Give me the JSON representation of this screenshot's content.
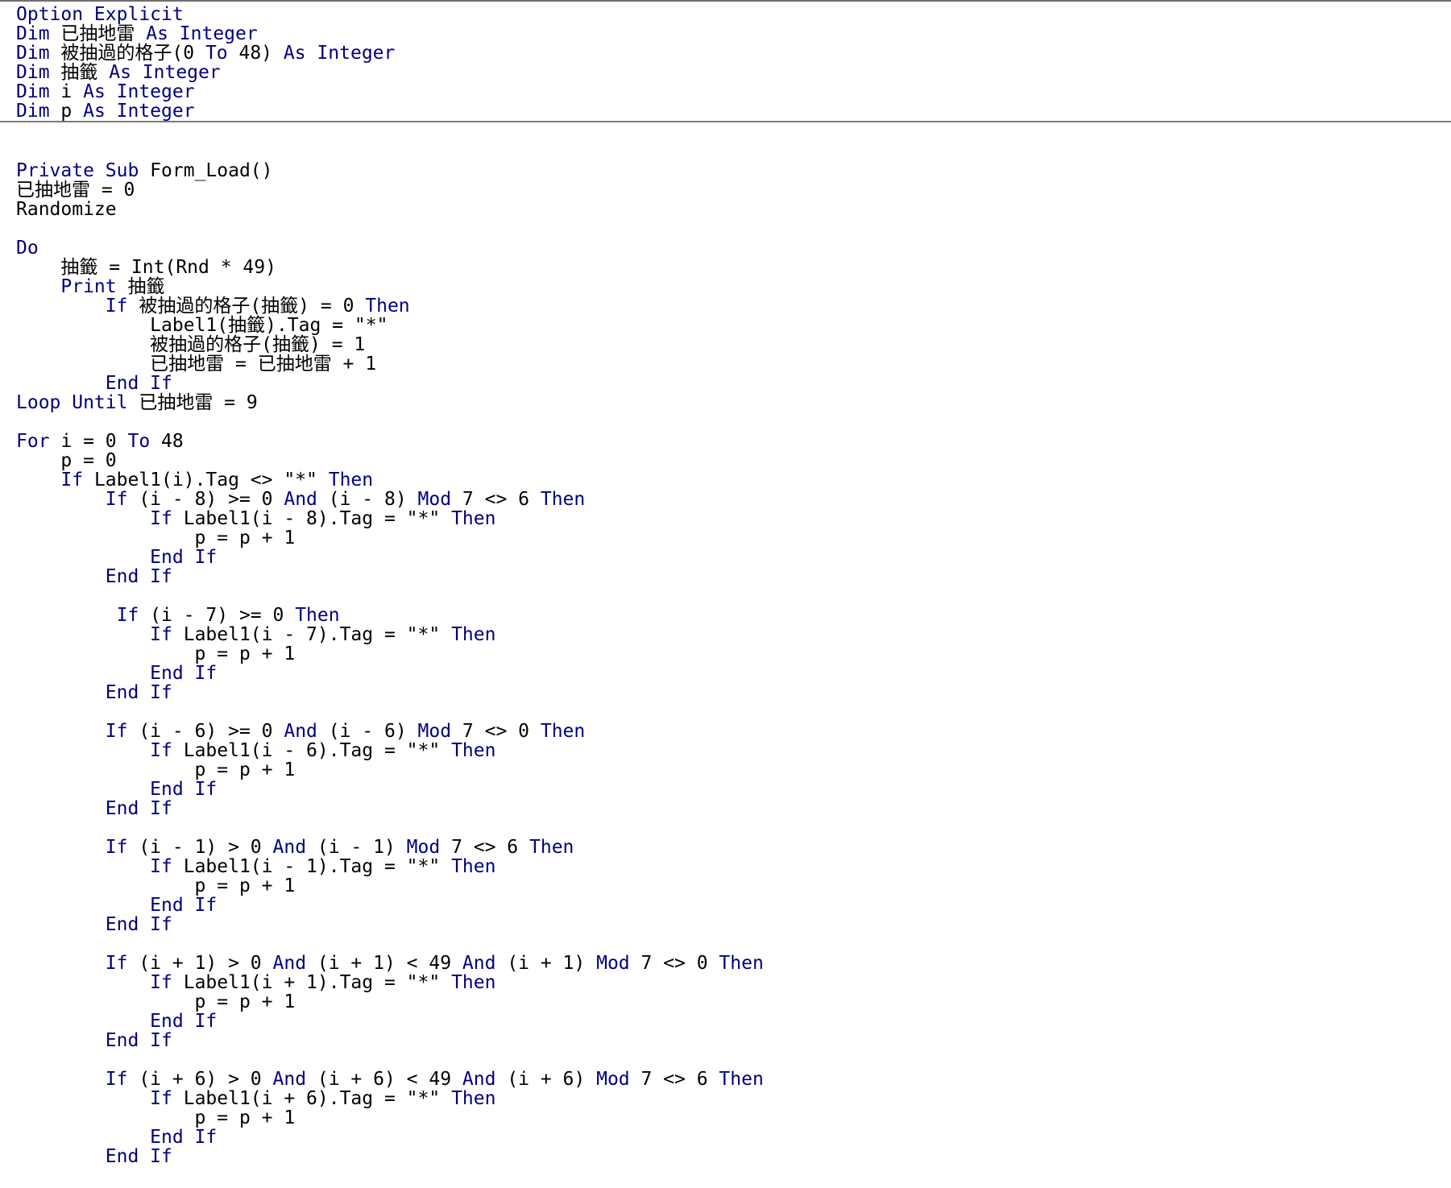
{
  "colors": {
    "keyword": "#00007f",
    "text": "#000000",
    "background": "#ffffff",
    "separator": "#7a7a7a"
  },
  "declarations": [
    [
      {
        "t": "Option Explicit",
        "k": true
      }
    ],
    [
      {
        "t": "Dim",
        "k": true
      },
      {
        "t": " 已抽地雷 "
      },
      {
        "t": "As Integer",
        "k": true
      }
    ],
    [
      {
        "t": "Dim",
        "k": true
      },
      {
        "t": " 被抽過的格子(0 "
      },
      {
        "t": "To",
        "k": true
      },
      {
        "t": " 48) "
      },
      {
        "t": "As Integer",
        "k": true
      }
    ],
    [
      {
        "t": "Dim",
        "k": true
      },
      {
        "t": " 抽籤 "
      },
      {
        "t": "As Integer",
        "k": true
      }
    ],
    [
      {
        "t": "Dim",
        "k": true
      },
      {
        "t": " i "
      },
      {
        "t": "As Integer",
        "k": true
      }
    ],
    [
      {
        "t": "Dim",
        "k": true
      },
      {
        "t": " p "
      },
      {
        "t": "As Integer",
        "k": true
      }
    ]
  ],
  "procedure": [
    [
      {
        "t": "Private Sub",
        "k": true
      },
      {
        "t": " Form_Load()"
      }
    ],
    [
      {
        "t": "已抽地雷 = 0"
      }
    ],
    [
      {
        "t": "Randomize"
      }
    ],
    [
      {
        "t": ""
      }
    ],
    [
      {
        "t": "Do",
        "k": true
      }
    ],
    [
      {
        "t": "    抽籤 = Int(Rnd * 49)"
      }
    ],
    [
      {
        "t": "    "
      },
      {
        "t": "Print",
        "k": true
      },
      {
        "t": " 抽籤"
      }
    ],
    [
      {
        "t": "        "
      },
      {
        "t": "If",
        "k": true
      },
      {
        "t": " 被抽過的格子(抽籤) = 0 "
      },
      {
        "t": "Then",
        "k": true
      }
    ],
    [
      {
        "t": "            Label1(抽籤).Tag = \"*\""
      }
    ],
    [
      {
        "t": "            被抽過的格子(抽籤) = 1"
      }
    ],
    [
      {
        "t": "            已抽地雷 = 已抽地雷 + 1"
      }
    ],
    [
      {
        "t": "        "
      },
      {
        "t": "End If",
        "k": true
      }
    ],
    [
      {
        "t": "Loop Until",
        "k": true
      },
      {
        "t": " 已抽地雷 = 9"
      }
    ],
    [
      {
        "t": ""
      }
    ],
    [
      {
        "t": "For",
        "k": true
      },
      {
        "t": " i = 0 "
      },
      {
        "t": "To",
        "k": true
      },
      {
        "t": " 48"
      }
    ],
    [
      {
        "t": "    p = 0"
      }
    ],
    [
      {
        "t": "    "
      },
      {
        "t": "If",
        "k": true
      },
      {
        "t": " Label1(i).Tag <> \"*\" "
      },
      {
        "t": "Then",
        "k": true
      }
    ],
    [
      {
        "t": "        "
      },
      {
        "t": "If",
        "k": true
      },
      {
        "t": " (i - 8) >= 0 "
      },
      {
        "t": "And",
        "k": true
      },
      {
        "t": " (i - 8) "
      },
      {
        "t": "Mod",
        "k": true
      },
      {
        "t": " 7 <> 6 "
      },
      {
        "t": "Then",
        "k": true
      }
    ],
    [
      {
        "t": "            "
      },
      {
        "t": "If",
        "k": true
      },
      {
        "t": " Label1(i - 8).Tag = \"*\" "
      },
      {
        "t": "Then",
        "k": true
      }
    ],
    [
      {
        "t": "                p = p + 1"
      }
    ],
    [
      {
        "t": "            "
      },
      {
        "t": "End If",
        "k": true
      }
    ],
    [
      {
        "t": "        "
      },
      {
        "t": "End If",
        "k": true
      }
    ],
    [
      {
        "t": ""
      }
    ],
    [
      {
        "t": "         "
      },
      {
        "t": "If",
        "k": true
      },
      {
        "t": " (i - 7) >= 0 "
      },
      {
        "t": "Then",
        "k": true
      }
    ],
    [
      {
        "t": "            "
      },
      {
        "t": "If",
        "k": true
      },
      {
        "t": " Label1(i - 7).Tag = \"*\" "
      },
      {
        "t": "Then",
        "k": true
      }
    ],
    [
      {
        "t": "                p = p + 1"
      }
    ],
    [
      {
        "t": "            "
      },
      {
        "t": "End If",
        "k": true
      }
    ],
    [
      {
        "t": "        "
      },
      {
        "t": "End If",
        "k": true
      }
    ],
    [
      {
        "t": ""
      }
    ],
    [
      {
        "t": "        "
      },
      {
        "t": "If",
        "k": true
      },
      {
        "t": " (i - 6) >= 0 "
      },
      {
        "t": "And",
        "k": true
      },
      {
        "t": " (i - 6) "
      },
      {
        "t": "Mod",
        "k": true
      },
      {
        "t": " 7 <> 0 "
      },
      {
        "t": "Then",
        "k": true
      }
    ],
    [
      {
        "t": "            "
      },
      {
        "t": "If",
        "k": true
      },
      {
        "t": " Label1(i - 6).Tag = \"*\" "
      },
      {
        "t": "Then",
        "k": true
      }
    ],
    [
      {
        "t": "                p = p + 1"
      }
    ],
    [
      {
        "t": "            "
      },
      {
        "t": "End If",
        "k": true
      }
    ],
    [
      {
        "t": "        "
      },
      {
        "t": "End If",
        "k": true
      }
    ],
    [
      {
        "t": ""
      }
    ],
    [
      {
        "t": "        "
      },
      {
        "t": "If",
        "k": true
      },
      {
        "t": " (i - 1) > 0 "
      },
      {
        "t": "And",
        "k": true
      },
      {
        "t": " (i - 1) "
      },
      {
        "t": "Mod",
        "k": true
      },
      {
        "t": " 7 <> 6 "
      },
      {
        "t": "Then",
        "k": true
      }
    ],
    [
      {
        "t": "            "
      },
      {
        "t": "If",
        "k": true
      },
      {
        "t": " Label1(i - 1).Tag = \"*\" "
      },
      {
        "t": "Then",
        "k": true
      }
    ],
    [
      {
        "t": "                p = p + 1"
      }
    ],
    [
      {
        "t": "            "
      },
      {
        "t": "End If",
        "k": true
      }
    ],
    [
      {
        "t": "        "
      },
      {
        "t": "End If",
        "k": true
      }
    ],
    [
      {
        "t": ""
      }
    ],
    [
      {
        "t": "        "
      },
      {
        "t": "If",
        "k": true
      },
      {
        "t": " (i + 1) > 0 "
      },
      {
        "t": "And",
        "k": true
      },
      {
        "t": " (i + 1) < 49 "
      },
      {
        "t": "And",
        "k": true
      },
      {
        "t": " (i + 1) "
      },
      {
        "t": "Mod",
        "k": true
      },
      {
        "t": " 7 <> 0 "
      },
      {
        "t": "Then",
        "k": true
      }
    ],
    [
      {
        "t": "            "
      },
      {
        "t": "If",
        "k": true
      },
      {
        "t": " Label1(i + 1).Tag = \"*\" "
      },
      {
        "t": "Then",
        "k": true
      }
    ],
    [
      {
        "t": "                p = p + 1"
      }
    ],
    [
      {
        "t": "            "
      },
      {
        "t": "End If",
        "k": true
      }
    ],
    [
      {
        "t": "        "
      },
      {
        "t": "End If",
        "k": true
      }
    ],
    [
      {
        "t": ""
      }
    ],
    [
      {
        "t": "        "
      },
      {
        "t": "If",
        "k": true
      },
      {
        "t": " (i + 6) > 0 "
      },
      {
        "t": "And",
        "k": true
      },
      {
        "t": " (i + 6) < 49 "
      },
      {
        "t": "And",
        "k": true
      },
      {
        "t": " (i + 6) "
      },
      {
        "t": "Mod",
        "k": true
      },
      {
        "t": " 7 <> 6 "
      },
      {
        "t": "Then",
        "k": true
      }
    ],
    [
      {
        "t": "            "
      },
      {
        "t": "If",
        "k": true
      },
      {
        "t": " Label1(i + 6).Tag = \"*\" "
      },
      {
        "t": "Then",
        "k": true
      }
    ],
    [
      {
        "t": "                p = p + 1"
      }
    ],
    [
      {
        "t": "            "
      },
      {
        "t": "End If",
        "k": true
      }
    ],
    [
      {
        "t": "        "
      },
      {
        "t": "End If",
        "k": true
      }
    ]
  ]
}
